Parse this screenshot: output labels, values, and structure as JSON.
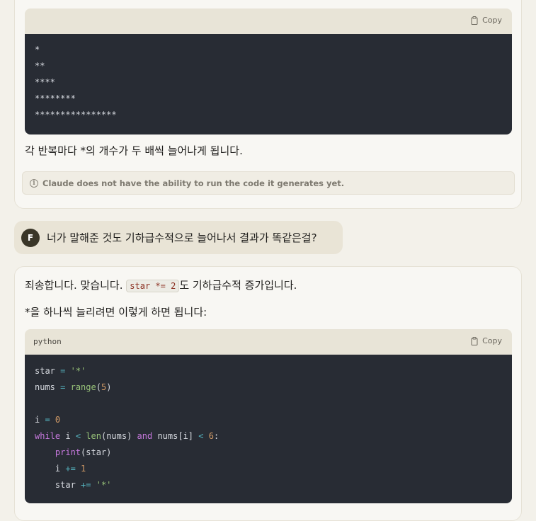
{
  "first_response": {
    "code_block": {
      "copy_label": "Copy",
      "lines": [
        "*",
        "**",
        "****",
        "********",
        "****************"
      ]
    },
    "explanation": "각 반복마다 *의 개수가 두 배씩 늘어나게 됩니다.",
    "disclaimer": "Claude does not have the ability to run the code it generates yet."
  },
  "user_message": {
    "avatar_initial": "F",
    "text": "너가 말해준 것도 기하급수적으로 늘어나서 결과가 똑같은걸?"
  },
  "second_response": {
    "line1_before": "죄송합니다. 맞습니다. ",
    "line1_code": "star *= 2",
    "line1_after": "도 기하급수적 증가입니다.",
    "line2": "*을 하나씩 늘리려면 이렇게 하면 됩니다:",
    "code_block": {
      "language": "python",
      "copy_label": "Copy"
    }
  },
  "colors": {
    "page_bg": "#f3f1ea",
    "code_bg": "#282c34",
    "code_header_bg": "#e8e4d7",
    "avatar_bg": "#3a3628",
    "user_bubble_bg": "#e9e4d6"
  },
  "icons": [
    "copy-icon",
    "info-icon"
  ]
}
